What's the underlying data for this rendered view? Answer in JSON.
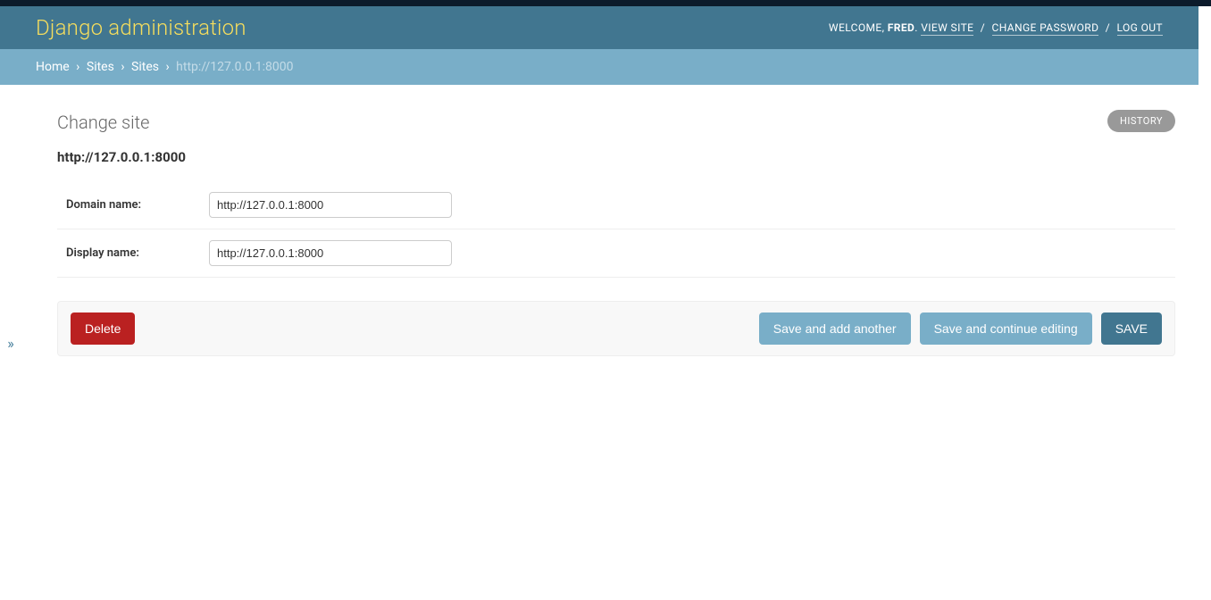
{
  "header": {
    "branding": "Django administration",
    "welcome_label": "WELCOME,",
    "username": "FRED",
    "view_site": "VIEW SITE",
    "change_password": "CHANGE PASSWORD",
    "logout": "LOG OUT"
  },
  "breadcrumbs": {
    "items": [
      "Home",
      "Sites",
      "Sites"
    ],
    "current": "http://127.0.0.1:8000",
    "sep": "›"
  },
  "page": {
    "title": "Change site",
    "history_label": "HISTORY",
    "object_repr": "http://127.0.0.1:8000"
  },
  "form": {
    "domain_name": {
      "label": "Domain name:",
      "value": "http://127.0.0.1:8000"
    },
    "display_name": {
      "label": "Display name:",
      "value": "http://127.0.0.1:8000"
    }
  },
  "actions": {
    "delete": "Delete",
    "save_add_another": "Save and add another",
    "save_continue": "Save and continue editing",
    "save": "SAVE"
  },
  "sidebar_toggle": "»"
}
